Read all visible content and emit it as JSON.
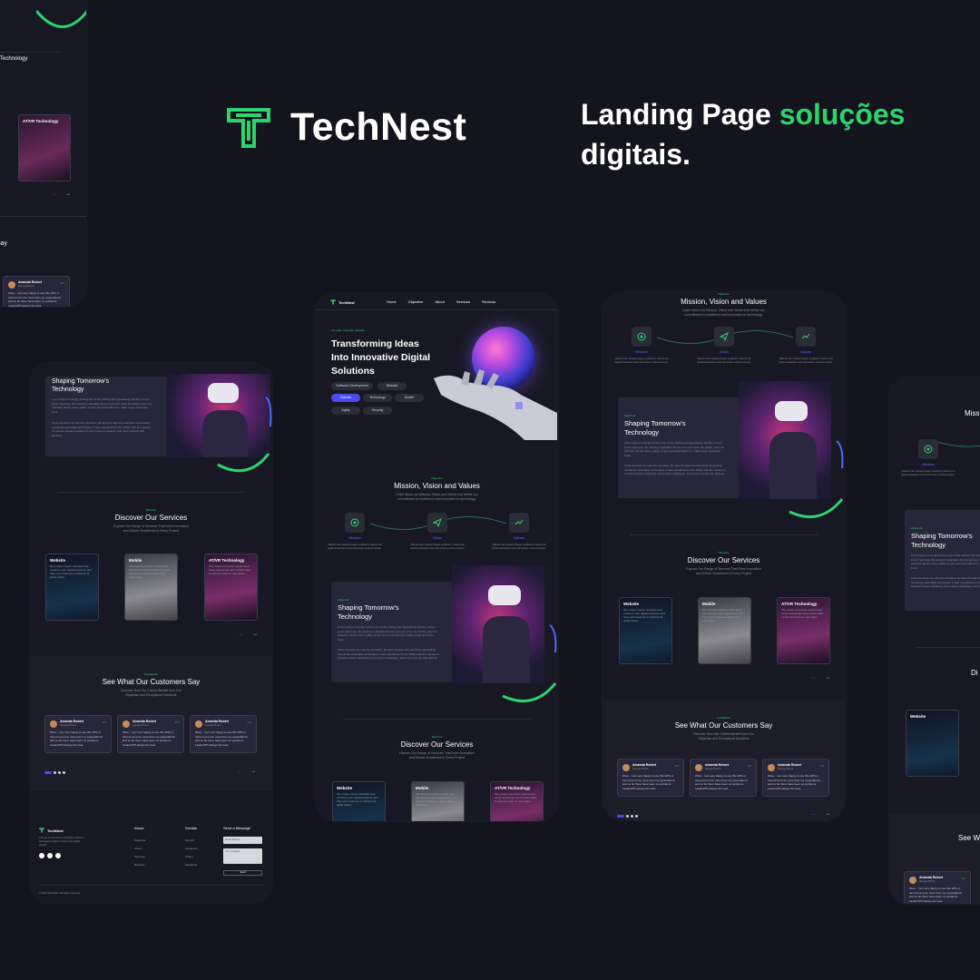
{
  "brand": {
    "name": "TechNest",
    "tagline_prefix": "Landing Page ",
    "tagline_accent": "soluções",
    "tagline_suffix": "digitais.",
    "accent_color": "#2ed36b",
    "secondary_color": "#4a4cf0"
  },
  "nav": {
    "logo": "TechNest",
    "items": [
      "Home",
      "Objective",
      "About",
      "Services",
      "Reviews"
    ]
  },
  "hero": {
    "eyebrow": "Innovate. Integrate. Elevate.",
    "title_line1": "Transforming Ideas",
    "title_line2": "Into Innovative Digital",
    "title_line3": "Solutions",
    "chips": [
      "Software Development",
      "Website",
      "Futures",
      "Technology",
      "Mobile",
      "Agility",
      "Security"
    ]
  },
  "mission": {
    "eyebrow": "Objective",
    "title": "Mission, Vision and Values",
    "subtitle_line1": "Learn about our Mission, Vision and Values that define our",
    "subtitle_line2": "commitment to excellence and innovation in technology.",
    "pillars": [
      {
        "label": "Mission",
        "icon": "target-icon",
        "desc": "Maecen inte volutpat integer vestibulum mauris nisi ligula consectetur semi nisi cursus, a elit eu tempor."
      },
      {
        "label": "Vision",
        "icon": "send-icon",
        "desc": "Maecen inte volutpat integer vestibulum mauris nisi ligula consectetur semi nisi cursus, a elit eu tempor."
      },
      {
        "label": "Values",
        "icon": "trend-icon",
        "desc": "Maecen inte volutpat integer vestibulum mauris nisi ligula consectetur semi nisi cursus, a elit eu tempor."
      }
    ]
  },
  "about": {
    "eyebrow": "About Us",
    "title_line1": "Shaping Tomorrow's",
    "title_line2": "Technology",
    "para1": "Lorem ipsum is simply dummy text of the printing and typesetting industry. Lorem ipsum has been the industry's standard dummy text ever since the 1500s, when an unknown printer took a galley of type and scrambled it to make a type specimen book.",
    "para2": "It has survived not only five centuries, but also the leap into electronic typesetting, remaining essentially unchanged. It was popularised in the 1960s with the release of Letraset sheets containing Lorem Ipsum passages, and more recently with desktop."
  },
  "services": {
    "eyebrow": "Services",
    "title": "Discover Our Services",
    "subtitle_line1": "Explore Our Range of Services That Drive Innovation",
    "subtitle_line2": "and Deliver Excellence in Every Project",
    "cards": [
      {
        "title": "Website",
        "desc": "We create custom websites that enhance your digital presence and help your business to achieve its goals online."
      },
      {
        "title": "Mobile",
        "desc": "We develop custom mobile apps that improve user experience and help your business reach more customers."
      },
      {
        "title": "AT/VR Technology",
        "desc": "We create immersive experiences using augmented and virtual reality to connect users in new ways."
      }
    ]
  },
  "reviews": {
    "eyebrow": "Feedbacks",
    "title": "See What Our Customers Say",
    "subtitle_line1": "Discover How Our Clients Benefit from Our",
    "subtitle_line2": "Expertise and Exceptional Solutions",
    "items": [
      {
        "name": "Amanda Robert",
        "role": "Manager Brand",
        "rating": "4.7",
        "text": "Wow... I am very happy to use this VPN, it turned out to be more than my expectations and so far there have been no problems. LaslesVPN always the best."
      },
      {
        "name": "Amanda Robert",
        "role": "Manager Brand",
        "rating": "4.7",
        "text": "Wow... I am very happy to use this VPN, it turned out to be more than my expectations and so far there have been no problems. LaslesVPN always the best."
      },
      {
        "name": "Amanda Robert",
        "role": "Manager Brand",
        "rating": "4.7",
        "text": "Wow... I am very happy to use this VPN, it turned out to be more than my expectations and so far there have been no problems. LaslesVPN always the best."
      }
    ]
  },
  "footer": {
    "logo": "TechNest",
    "blurb": "Your go-to tech hub for innovative solutions and expert insights to boost your digital growth.",
    "about_title": "About",
    "about_links": [
      "Objective",
      "About",
      "Services",
      "Reviews"
    ],
    "socials_title": "Socials",
    "social_links": [
      "Discord",
      "Instagram",
      "Twitter",
      "Facebook"
    ],
    "message_title": "Send a Message",
    "email_placeholder": "Email address",
    "message_placeholder": "Your message",
    "send_label": "Send",
    "copyright": "© 2024 TechNest. All rights reserved."
  }
}
